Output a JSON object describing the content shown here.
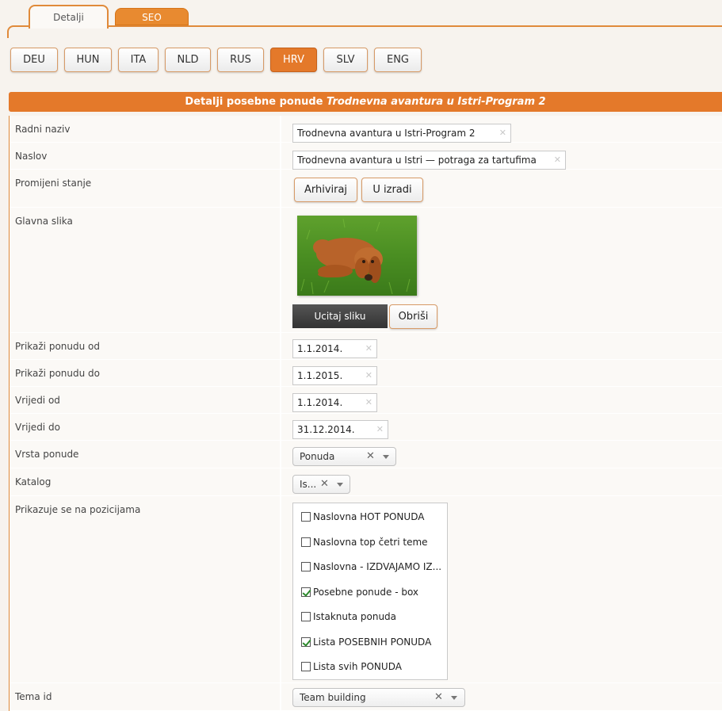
{
  "tabs": [
    {
      "label": "Detalji",
      "active": true
    },
    {
      "label": "SEO",
      "active": false
    }
  ],
  "languages": [
    {
      "label": "DEU",
      "active": false
    },
    {
      "label": "HUN",
      "active": false
    },
    {
      "label": "ITA",
      "active": false
    },
    {
      "label": "NLD",
      "active": false
    },
    {
      "label": "RUS",
      "active": false
    },
    {
      "label": "HRV",
      "active": true
    },
    {
      "label": "SLV",
      "active": false
    },
    {
      "label": "ENG",
      "active": false
    }
  ],
  "header": {
    "prefix": "Detalji posebne ponude ",
    "offer_name": "Trodnevna avantura u Istri-Program 2"
  },
  "form": {
    "radni_naziv": {
      "label": "Radni naziv",
      "value": "Trodnevna avantura u Istri-Program 2"
    },
    "naslov": {
      "label": "Naslov",
      "value": "Trodnevna avantura u Istri — potraga za tartufima"
    },
    "stanje": {
      "label": "Promijeni stanje",
      "archive_label": "Arhiviraj",
      "inprogress_label": "U izradi"
    },
    "slika": {
      "label": "Glavna slika",
      "upload_label": "Ucitaj sliku",
      "delete_label": "Obriši"
    },
    "prikazi_od": {
      "label": "Prikaži ponudu od",
      "value": "1.1.2014."
    },
    "prikazi_do": {
      "label": "Prikaži ponudu do",
      "value": "1.1.2015."
    },
    "vrijedi_od": {
      "label": "Vrijedi od",
      "value": "1.1.2014."
    },
    "vrijedi_do": {
      "label": "Vrijedi do",
      "value": "31.12.2014."
    },
    "vrsta": {
      "label": "Vrsta ponude",
      "value": "Ponuda"
    },
    "katalog": {
      "label": "Katalog",
      "value": "Is..."
    },
    "pozicije": {
      "label": "Prikazuje se na pozicijama",
      "items": [
        {
          "label": "Naslovna HOT PONUDA",
          "checked": false
        },
        {
          "label": "Naslovna top četri teme",
          "checked": false
        },
        {
          "label": "Naslovna - IZDVAJAMO IZ...",
          "checked": false
        },
        {
          "label": "Posebne ponude - box",
          "checked": true
        },
        {
          "label": "Istaknuta ponuda",
          "checked": false
        },
        {
          "label": "Lista POSEBNIH PONUDA",
          "checked": true
        },
        {
          "label": "Lista svih PONUDA",
          "checked": false
        }
      ]
    },
    "tema": {
      "label": "Tema id",
      "value": "Team building"
    }
  },
  "colors": {
    "accent": "#e4792a",
    "seo_tab": "#e88a30",
    "checkmark": "#2d8a2d"
  }
}
